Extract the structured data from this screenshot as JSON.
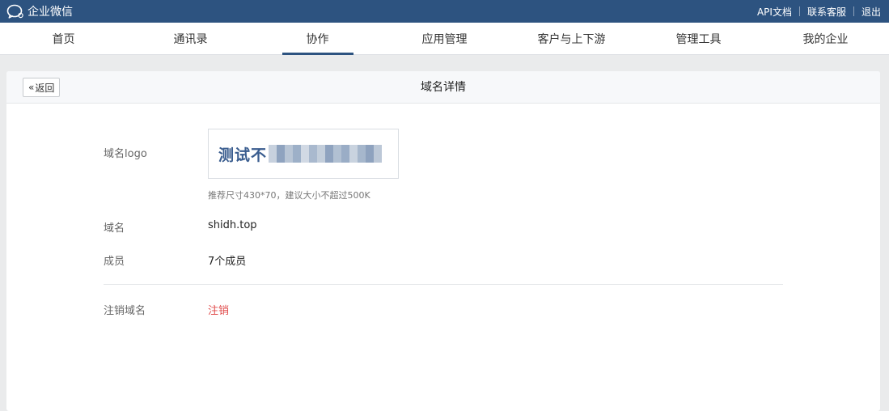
{
  "topbar": {
    "brand": "企业微信",
    "links": [
      "API文档",
      "联系客服",
      "退出"
    ]
  },
  "nav": {
    "items": [
      "首页",
      "通讯录",
      "协作",
      "应用管理",
      "客户与上下游",
      "管理工具",
      "我的企业"
    ],
    "active_index": 2
  },
  "detail": {
    "back_label": "返回",
    "title": "域名详情",
    "logo_label": "域名logo",
    "logo_text": "测试不",
    "logo_hint": "推荐尺寸430*70，建议大小不超过500K",
    "domain_label": "域名",
    "domain_value": "shidh.top",
    "members_label": "成员",
    "members_value": "7个成员",
    "cancel_label": "注销域名",
    "cancel_action": "注销"
  },
  "colors": {
    "topbar": "#2d5380",
    "nav_active": "#2d5380",
    "danger": "#e04a4a",
    "logo_text": "#3a5d8f"
  },
  "icons": {
    "brand": "chat-bubble-icon",
    "back": "double-chevron-left-icon"
  }
}
